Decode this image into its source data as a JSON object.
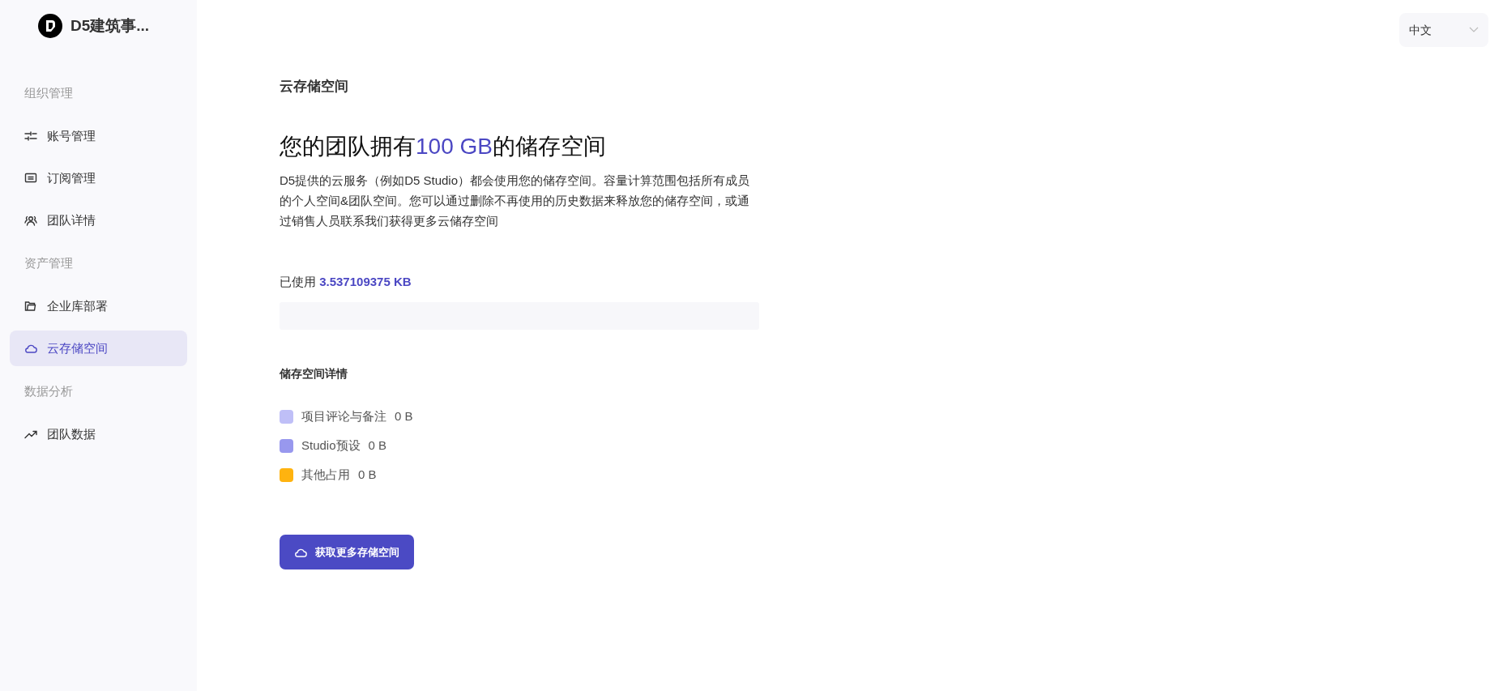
{
  "brand": {
    "name": "D5建筑事..."
  },
  "sidebar": {
    "sections": [
      {
        "title": "组织管理",
        "items": [
          {
            "label": "账号管理",
            "selected": false
          },
          {
            "label": "订阅管理",
            "selected": false
          },
          {
            "label": "团队详情",
            "selected": false
          }
        ]
      },
      {
        "title": "资产管理",
        "items": [
          {
            "label": "企业库部署",
            "selected": false
          },
          {
            "label": "云存储空间",
            "selected": true
          }
        ]
      },
      {
        "title": "数据分析",
        "items": [
          {
            "label": "团队数据",
            "selected": false
          }
        ]
      }
    ]
  },
  "language_select": {
    "value": "中文"
  },
  "page": {
    "title": "云存储空间",
    "heading_before": "您的团队拥有",
    "heading_amount": "100 GB",
    "heading_after": "的储存空间",
    "description": "D5提供的云服务（例如D5 Studio）都会使用您的储存空间。容量计算范围包括所有成员的个人空间&团队空间。您可以通过删除不再使用的历史数据来释放您的储存空间，或通过销售人员联系我们获得更多云储存空间",
    "used_label": "已使用",
    "used_value": "3.537109375 KB",
    "details_title": "储存空间详情",
    "legend": [
      {
        "label": "项目评论与备注",
        "value": "0 B",
        "color": "#bfbff7"
      },
      {
        "label": "Studio预设",
        "value": "0 B",
        "color": "#9898ee"
      },
      {
        "label": "其他占用",
        "value": "0 B",
        "color": "#ffb30f"
      }
    ],
    "button": "获取更多存储空间"
  }
}
